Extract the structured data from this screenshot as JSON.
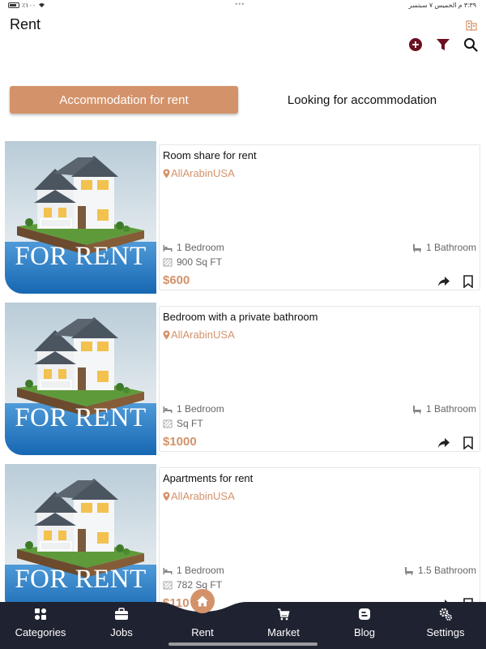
{
  "status_bar": {
    "battery": "٪۱۰۰",
    "datetime": "۳:۳۹ م   الخميس ۷ سبتمبر",
    "dots": "•••"
  },
  "header": {
    "title": "Rent"
  },
  "tabs": [
    {
      "label": "Accommodation for rent",
      "active": true
    },
    {
      "label": "Looking for accommodation",
      "active": false
    }
  ],
  "listings": [
    {
      "image_text": "FOR RENT",
      "title": "Room share for rent",
      "location": "AllArabinUSA",
      "bedroom": "1 Bedroom",
      "bathroom": "1 Bathroom",
      "area": "900 Sq FT",
      "price": "$600"
    },
    {
      "image_text": "FOR RENT",
      "title": "Bedroom with a private bathroom",
      "location": "AllArabinUSA",
      "bedroom": "1 Bedroom",
      "bathroom": "1 Bathroom",
      "area": " Sq FT",
      "price": "$1000"
    },
    {
      "image_text": "FOR RENT",
      "title": "Apartments for rent",
      "location": "AllArabinUSA",
      "bedroom": "1 Bedroom",
      "bathroom": "1.5 Bathroom",
      "area": "782 Sq FT",
      "price": "$110"
    }
  ],
  "bottom_nav": [
    {
      "label": "Categories",
      "icon": "categories-icon"
    },
    {
      "label": "Jobs",
      "icon": "briefcase-icon"
    },
    {
      "label": "Rent",
      "icon": "home-icon",
      "active": true
    },
    {
      "label": "Market",
      "icon": "cart-icon"
    },
    {
      "label": "Blog",
      "icon": "blog-icon"
    },
    {
      "label": "Settings",
      "icon": "gears-icon"
    }
  ],
  "colors": {
    "accent": "#d4926a",
    "dark_accent": "#6b1020",
    "nav_bg": "#1f2230"
  }
}
